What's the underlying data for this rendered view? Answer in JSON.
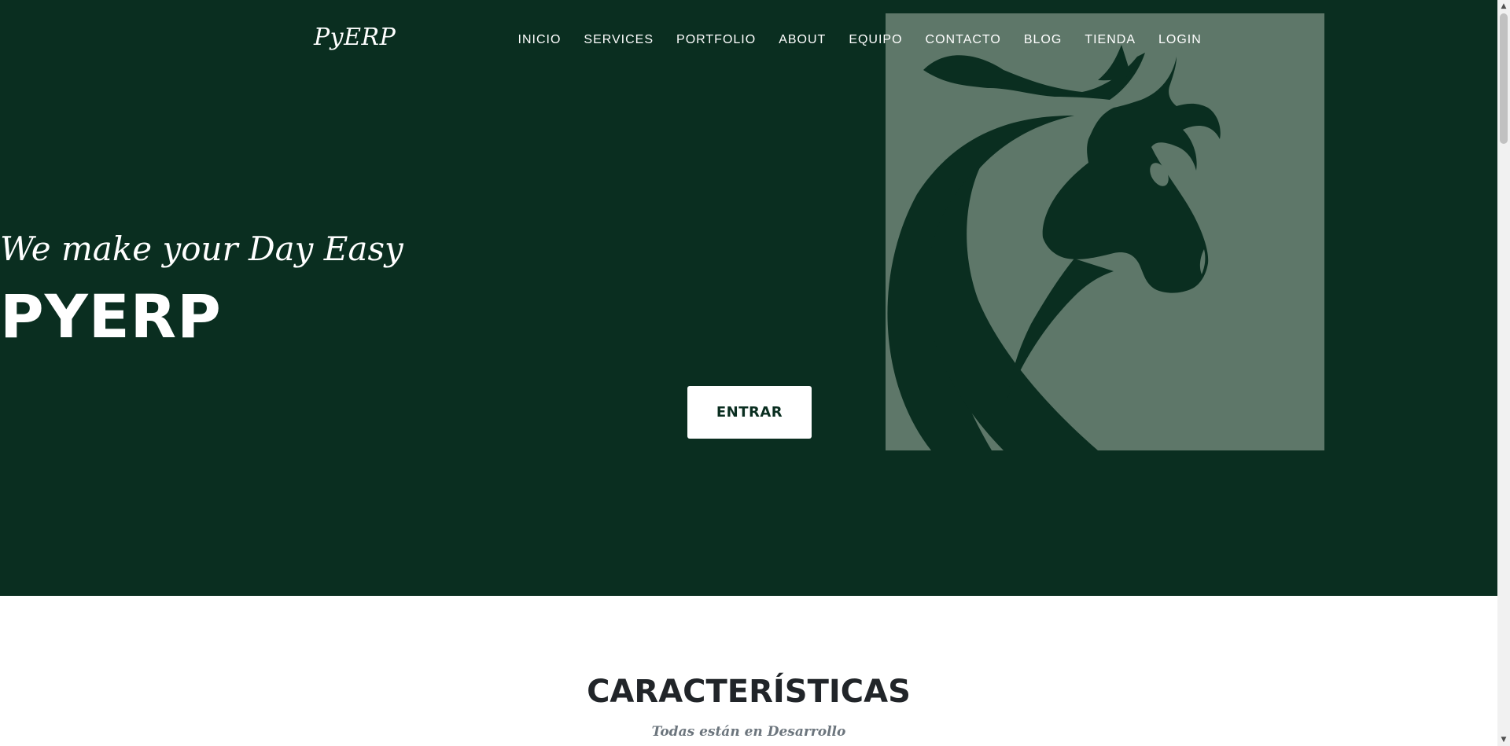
{
  "brand": {
    "name": "PyERP"
  },
  "nav": {
    "items": [
      {
        "label": "INICIO"
      },
      {
        "label": "SERVICES"
      },
      {
        "label": "PORTFOLIO"
      },
      {
        "label": "ABOUT"
      },
      {
        "label": "EQUIPO"
      },
      {
        "label": "CONTACTO"
      },
      {
        "label": "BLOG"
      },
      {
        "label": "TIENDA"
      },
      {
        "label": "LOGIN"
      }
    ]
  },
  "hero": {
    "subheading": "We make your Day Easy",
    "heading": "PYERP",
    "button_label": "ENTRAR",
    "background_image": "horse-head-icon"
  },
  "features": {
    "heading": "CARACTERÍSTICAS",
    "subheading": "Todas están en Desarrollo"
  },
  "scrollbar": {
    "up_icon": "scroll-up-arrow-icon",
    "down_icon": "scroll-down-arrow-icon"
  },
  "colors": {
    "hero_background": "#0a2e20",
    "horse_panel": "#5e7769",
    "button_background": "#ffffff",
    "button_text": "#0a2e20",
    "heading_text": "#212529",
    "subheading_text": "#6c757d"
  }
}
